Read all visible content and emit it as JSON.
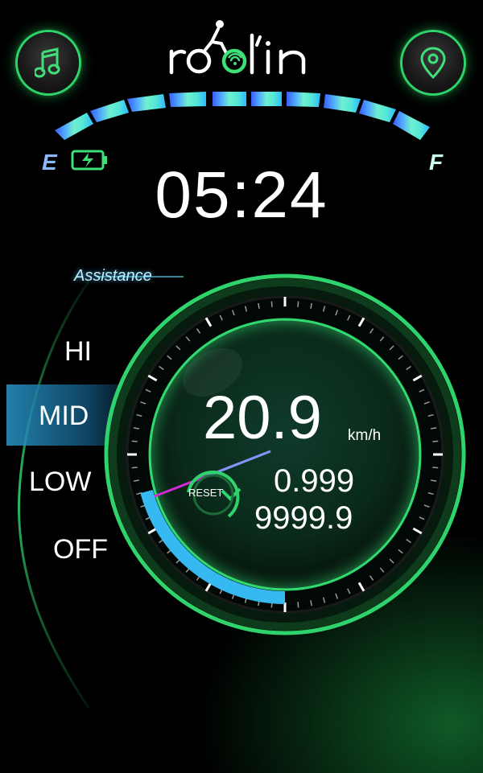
{
  "app": {
    "logo_text": "roolin"
  },
  "battery": {
    "empty_label": "E",
    "full_label": "F",
    "level": 1.0
  },
  "clock": {
    "time": "05:24"
  },
  "assistance": {
    "title": "Assistance",
    "levels": [
      "HI",
      "MID",
      "LOW",
      "OFF"
    ],
    "selected": "MID"
  },
  "dashboard": {
    "speed": "20.9",
    "speed_unit": "km/h",
    "trip": "0.999",
    "odometer": "9999.9",
    "reset_label": "RESET"
  },
  "colors": {
    "accent": "#2fd36b",
    "highlight": "#2a9fd0"
  },
  "icons": {
    "left_button": "music-note-icon",
    "right_button": "map-pin-icon"
  }
}
